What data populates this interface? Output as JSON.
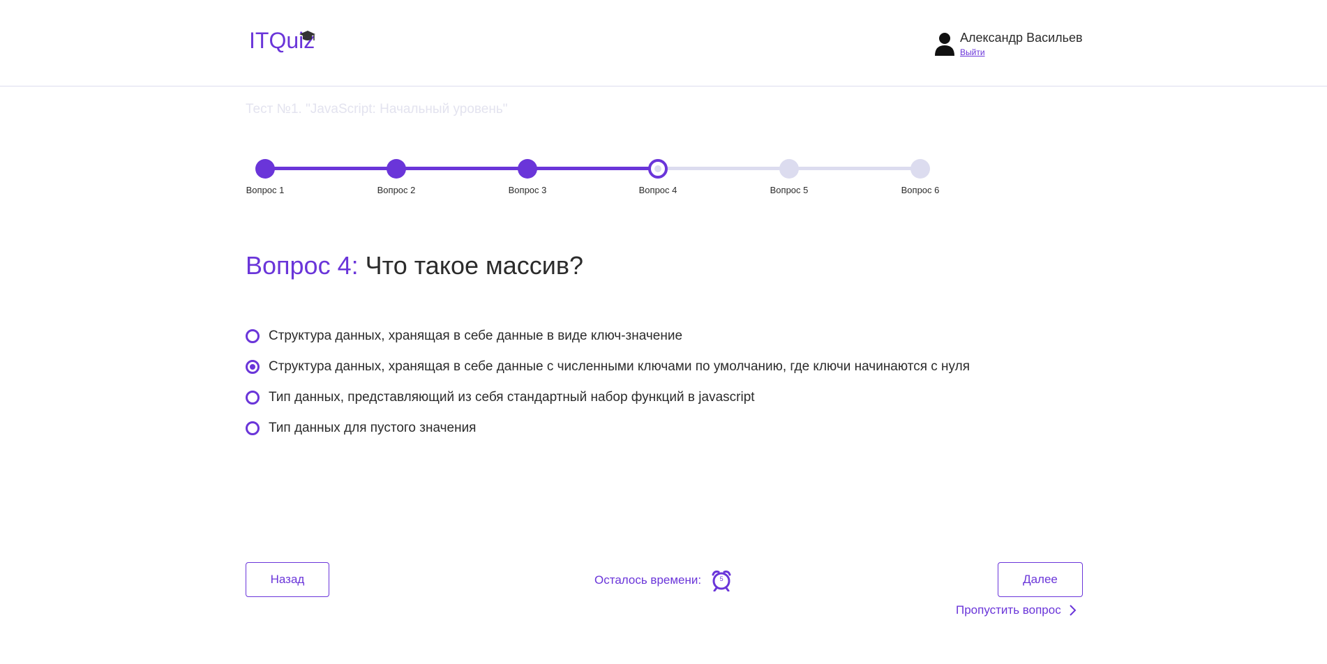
{
  "brand": {
    "logo_text": "ITQuiz",
    "accent": "#6a35d9"
  },
  "user": {
    "name": "Александр Васильев",
    "logout_label": "Выйти",
    "icon": "user-icon"
  },
  "test": {
    "title": "Тест №1. \"JavaScript: Начальный уровень\""
  },
  "progress": {
    "current_step": 4,
    "steps": [
      {
        "label": "Вопрос 1",
        "state": "done"
      },
      {
        "label": "Вопрос 2",
        "state": "done"
      },
      {
        "label": "Вопрос 3",
        "state": "done"
      },
      {
        "label": "Вопрос 4",
        "state": "current"
      },
      {
        "label": "Вопрос 5",
        "state": "todo"
      },
      {
        "label": "Вопрос 6",
        "state": "todo"
      }
    ]
  },
  "question": {
    "number_label": "Вопрос 4:",
    "text": "Что такое массив?",
    "answers": [
      {
        "text": "Структура данных, хранящая в себе данные в виде ключ-значение",
        "selected": false
      },
      {
        "text": "Структура данных, хранящая в себе данные с численными ключами по умолчанию, где ключи начинаются с нуля",
        "selected": true
      },
      {
        "text": "Тип данных, представляющий из себя стандартный набор функций в javascript",
        "selected": false
      },
      {
        "text": "Тип данных для пустого значения",
        "selected": false
      }
    ]
  },
  "footer": {
    "back_label": "Назад",
    "next_label": "Далее",
    "timer_label": "Осталось времени:",
    "timer_value": "5",
    "timer_icon": "alarm-clock-icon",
    "skip_label": "Пропустить вопрос",
    "skip_icon": "chevron-right-icon"
  }
}
